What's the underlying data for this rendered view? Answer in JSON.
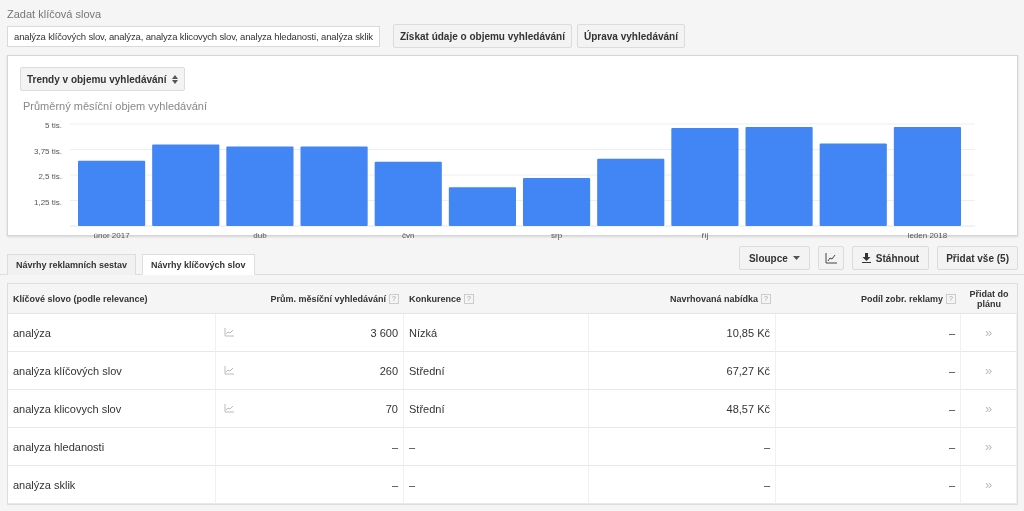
{
  "search": {
    "label": "Zadat klíčová slova",
    "value": "analýza klíčových slov, analýza, analyza klicovych slov, analyza hledanosti, analýza sklik",
    "buttons": [
      "Získat údaje o objemu vyhledávání",
      "Úprava vyhledávání"
    ]
  },
  "chart_panel": {
    "selector": "Trendy v objemu vyhledávání",
    "chart_data": {
      "type": "bar",
      "title": "Průměrný měsíční objem vyhledávání",
      "categories": [
        "únor 2017",
        null,
        "dub",
        null,
        "čvn",
        null,
        "srp",
        null,
        "říj",
        null,
        null,
        "leden 2018"
      ],
      "series": [
        {
          "color": "#4285f4",
          "values": [
            3.2,
            4.0,
            3.9,
            3.9,
            3.15,
            1.9,
            2.35,
            3.3,
            4.8,
            4.85,
            4.05,
            4.85
          ]
        }
      ],
      "grid": true,
      "ylim": [
        0,
        5
      ],
      "yticks": [
        {
          "value": 1.25,
          "label": "1,25 tis."
        },
        {
          "value": 2.5,
          "label": "2,5 tis."
        },
        {
          "value": 3.75,
          "label": "3,75 tis."
        },
        {
          "value": 5,
          "label": "5 tis."
        }
      ]
    }
  },
  "tabs": [
    {
      "label": "Návrhy reklamních sestav",
      "selected": false
    },
    {
      "label": "Návrhy klíčových slov",
      "selected": true
    }
  ],
  "toolbar": {
    "columns_button": "Sloupce",
    "download_button": "Stáhnout",
    "add_all_button": "Přidat vše (5)"
  },
  "table": {
    "columns": [
      {
        "label": "Klíčové slovo (podle relevance)"
      },
      {
        "label": "Prům. měsíční vyhledávání",
        "help": "?"
      },
      {
        "label": "Konkurence",
        "help": "?"
      },
      {
        "label": "Navrhovaná nabídka",
        "help": "?"
      },
      {
        "label": "Podíl zobr. reklamy",
        "help": "?"
      },
      {
        "label": "Přidat do plánu"
      }
    ],
    "rows": [
      {
        "keyword": "analýza",
        "trend": true,
        "searches": "3 600",
        "competition": "Nízká",
        "bid": "10,85 Kč",
        "share": "–",
        "add": "»"
      },
      {
        "keyword": "analýza klíčových slov",
        "trend": true,
        "searches": "260",
        "competition": "Střední",
        "bid": "67,27 Kč",
        "share": "–",
        "add": "»"
      },
      {
        "keyword": "analyza klicovych slov",
        "trend": true,
        "searches": "70",
        "competition": "Střední",
        "bid": "48,57 Kč",
        "share": "–",
        "add": "»"
      },
      {
        "keyword": "analyza hledanosti",
        "trend": false,
        "searches": "–",
        "competition": "–",
        "bid": "–",
        "share": "–",
        "add": "»"
      },
      {
        "keyword": "analýza sklik",
        "trend": false,
        "searches": "–",
        "competition": "–",
        "bid": "–",
        "share": "–",
        "add": "»"
      }
    ]
  }
}
